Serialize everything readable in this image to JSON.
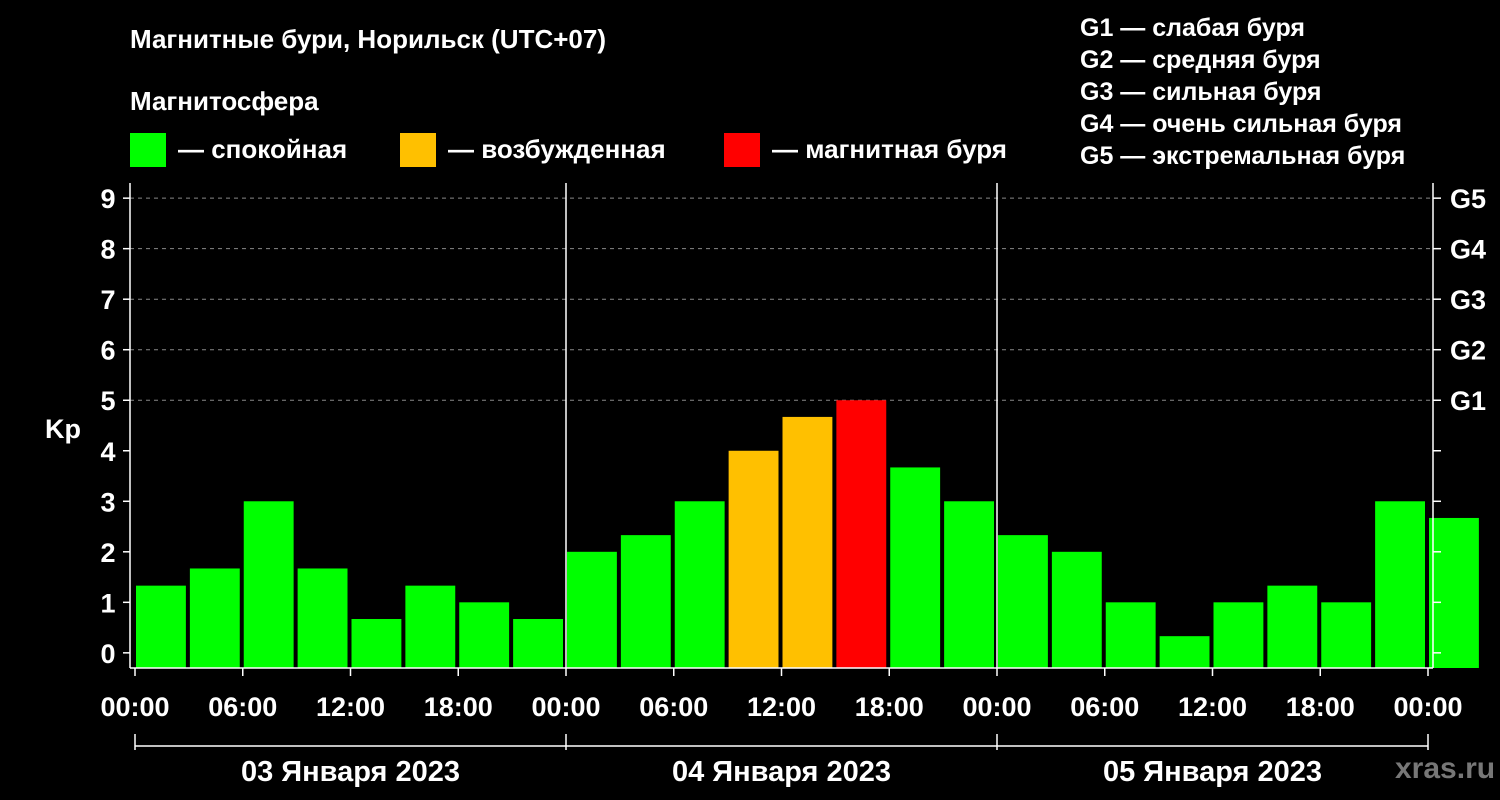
{
  "title": "Магнитные бури, Норильск (UTC+07)",
  "magnetosphere": {
    "title": "Магнитосфера",
    "items": [
      {
        "label": "— спокойная",
        "color": "#00ff00"
      },
      {
        "label": "— возбужденная",
        "color": "#ffc000"
      },
      {
        "label": "— магнитная буря",
        "color": "#ff0000"
      }
    ]
  },
  "g_scale": [
    "G1 — слабая буря",
    "G2 — средняя буря",
    "G3 — сильная буря",
    "G4 — очень сильная буря",
    "G5 — экстремальная буря"
  ],
  "watermark": "xras.ru",
  "chart_data": {
    "type": "bar",
    "ylabel": "Kp",
    "ylim": [
      -0.3,
      9.3
    ],
    "yticks": [
      0,
      1,
      2,
      3,
      4,
      5,
      6,
      7,
      8,
      9
    ],
    "right_ticks": [
      {
        "value": 5,
        "label": "G1"
      },
      {
        "value": 6,
        "label": "G2"
      },
      {
        "value": 7,
        "label": "G3"
      },
      {
        "value": 8,
        "label": "G4"
      },
      {
        "value": 9,
        "label": "G5"
      }
    ],
    "grid": true,
    "xticks": [
      "00:00",
      "06:00",
      "12:00",
      "18:00",
      "00:00",
      "06:00",
      "12:00",
      "18:00",
      "00:00",
      "06:00",
      "12:00",
      "18:00",
      "00:00"
    ],
    "days": [
      "03 Января 2023",
      "04 Января 2023",
      "05 Января 2023"
    ],
    "interval_hours": 3,
    "values": [
      1.33,
      1.67,
      3.0,
      1.67,
      0.67,
      1.33,
      1.0,
      0.67,
      2.0,
      2.33,
      3.0,
      4.0,
      4.67,
      5.0,
      3.67,
      3.0,
      2.33,
      2.0,
      1.0,
      0.33,
      1.0,
      1.33,
      1.0,
      3.0,
      2.67
    ],
    "colors": {
      "calm": "#00ff00",
      "active": "#ffc000",
      "storm": "#ff0000"
    }
  }
}
